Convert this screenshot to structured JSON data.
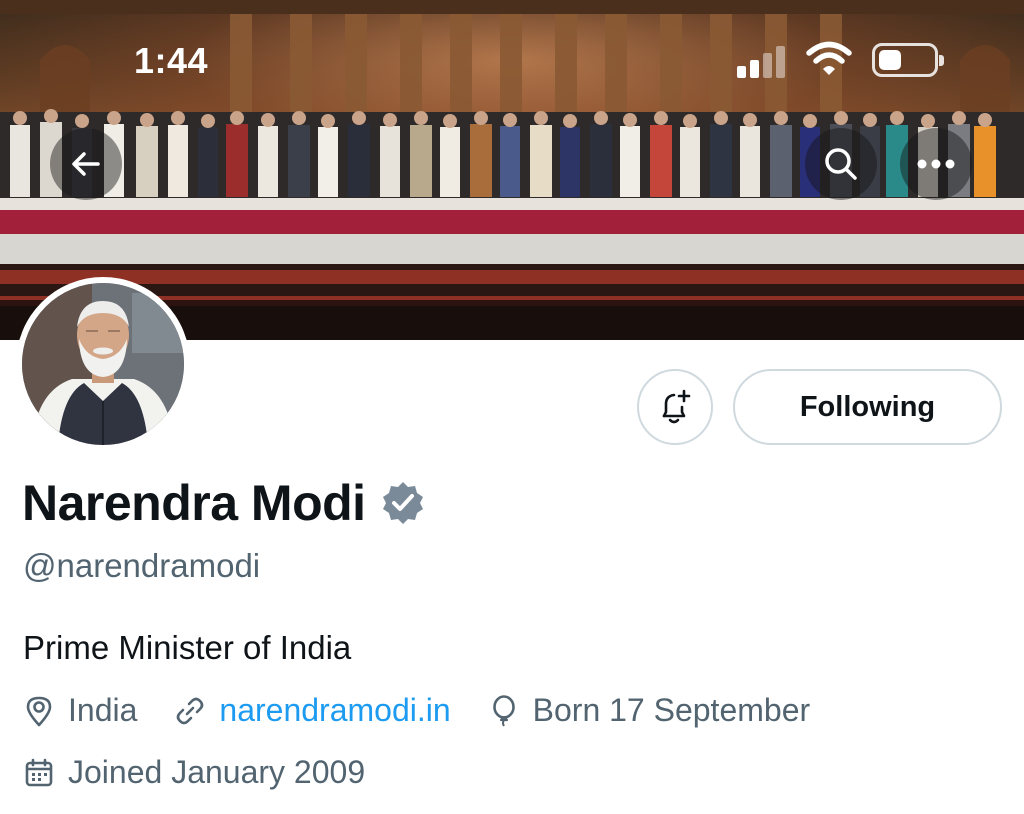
{
  "status_bar": {
    "time": "1:44"
  },
  "header": {
    "back_icon": "arrow-left-icon",
    "search_icon": "search-icon",
    "more_icon": "more-horizontal-icon"
  },
  "actions": {
    "notify_icon": "bell-plus-icon",
    "following_label": "Following"
  },
  "profile": {
    "display_name": "Narendra Modi",
    "verified_icon": "verified-badge-icon",
    "handle": "@narendramodi",
    "bio": "Prime Minister of India",
    "location": "India",
    "website": "narendramodi.in",
    "birthday": "Born 17 September",
    "joined": "Joined January 2009"
  },
  "colors": {
    "link": "#1d9bf0",
    "secondary_text": "#536471",
    "primary_text": "#0f1419",
    "border": "#cfd9de",
    "badge": "#7a8a99"
  }
}
